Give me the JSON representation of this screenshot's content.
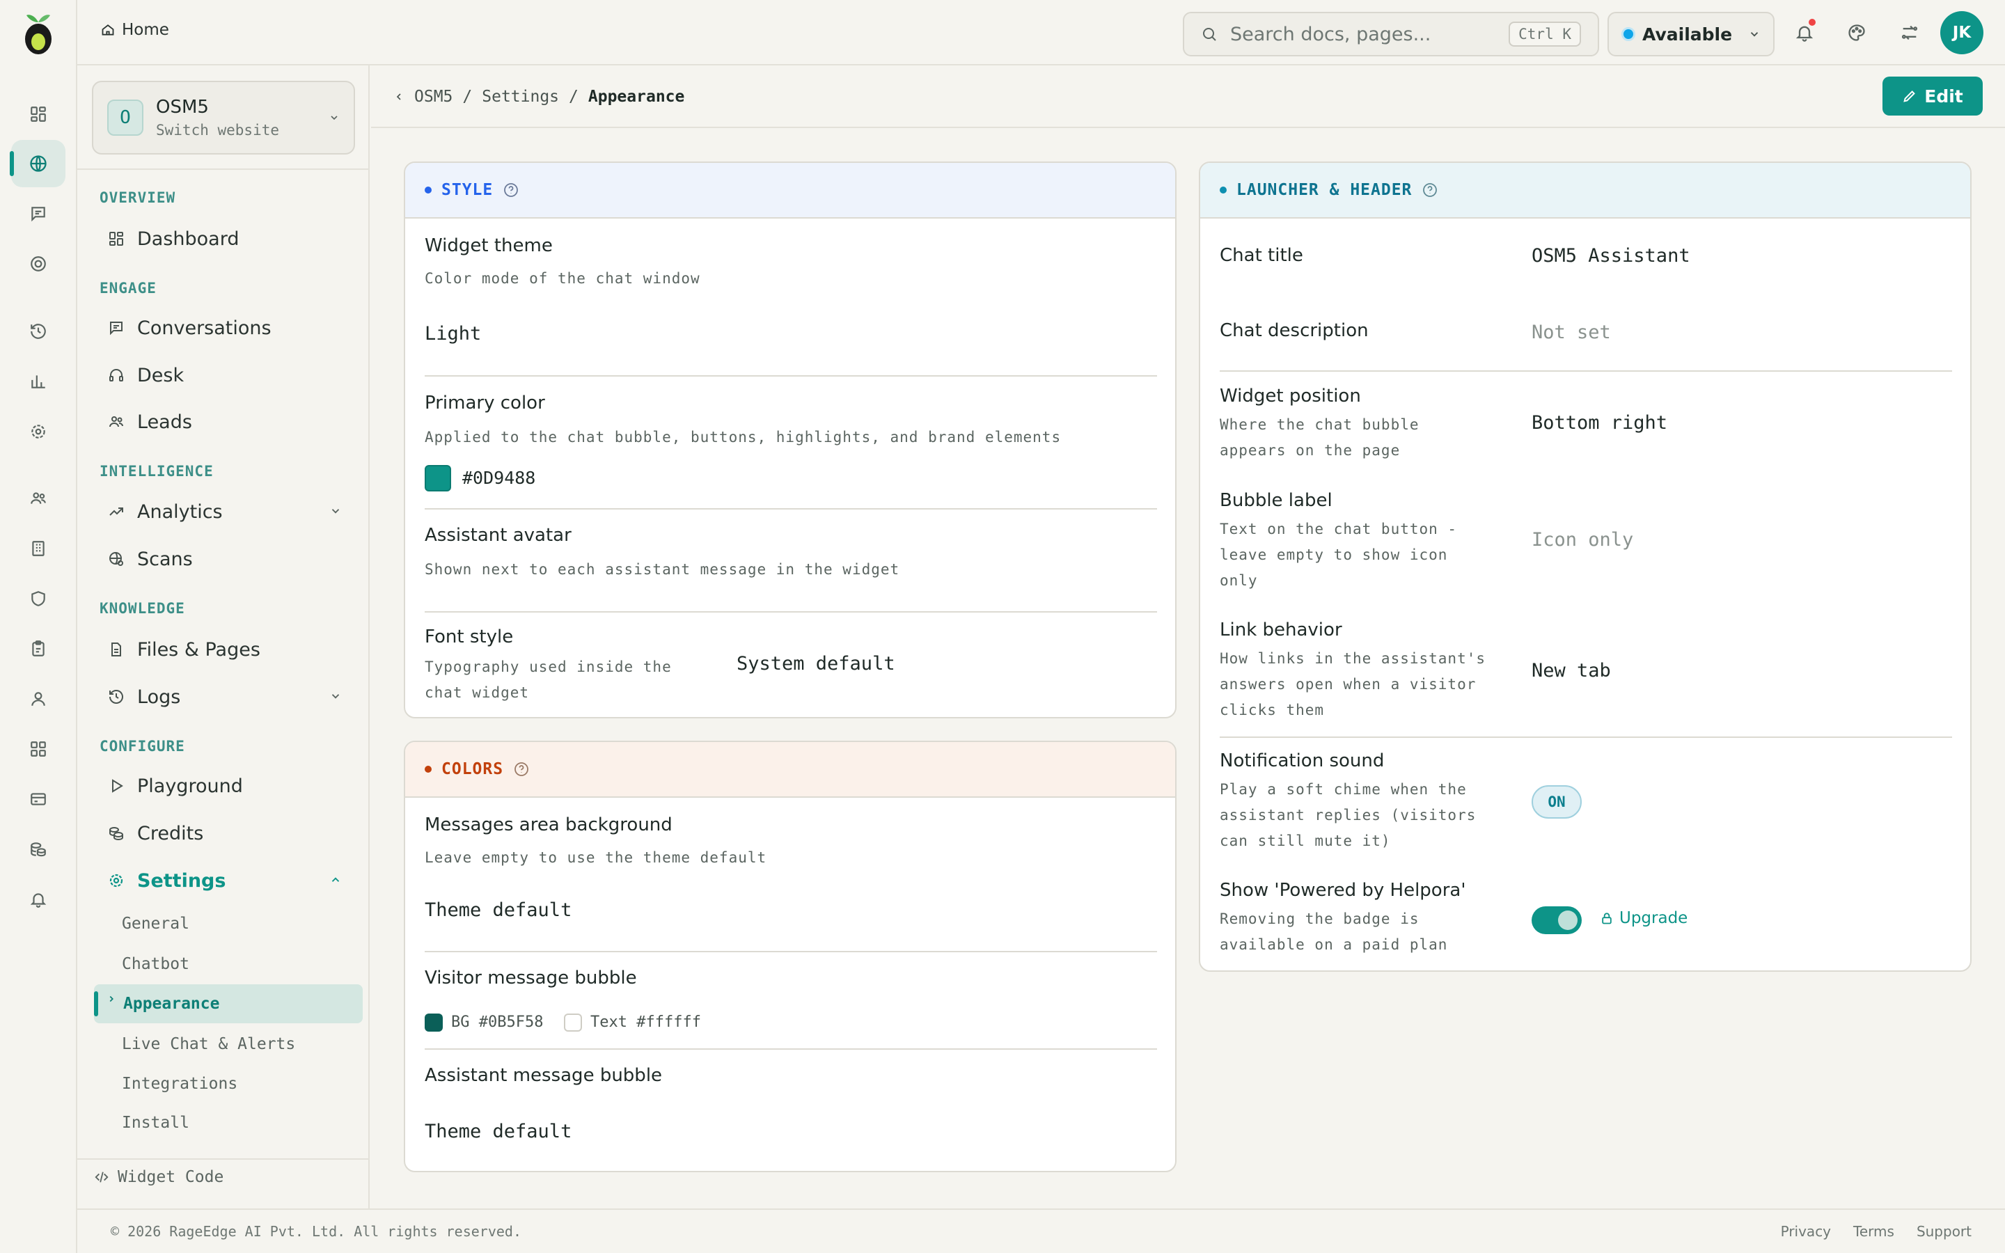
{
  "topbar": {
    "home_label": "Home",
    "search_placeholder": "Search docs, pages...",
    "search_shortcut": "Ctrl K",
    "status_label": "Available",
    "user_initials": "JK"
  },
  "site": {
    "initial": "O",
    "name": "OSM5",
    "switch_label": "Switch website"
  },
  "sidebar": {
    "sections": [
      "OVERVIEW",
      "ENGAGE",
      "INTELLIGENCE",
      "KNOWLEDGE",
      "CONFIGURE"
    ],
    "items": {
      "dashboard": "Dashboard",
      "conversations": "Conversations",
      "desk": "Desk",
      "leads": "Leads",
      "analytics": "Analytics",
      "scans": "Scans",
      "files": "Files & Pages",
      "logs": "Logs",
      "playground": "Playground",
      "credits": "Credits",
      "settings": "Settings"
    },
    "settings_sub": [
      "General",
      "Chatbot",
      "Appearance",
      "Live Chat & Alerts",
      "Integrations",
      "Install"
    ],
    "widget_code": "Widget Code"
  },
  "breadcrumb": [
    "OSM5",
    "Settings",
    "Appearance"
  ],
  "edit_label": "Edit",
  "style": {
    "header": "STYLE",
    "theme_title": "Widget theme",
    "theme_desc": "Color mode of the chat window",
    "theme_value": "Light",
    "primary_title": "Primary color",
    "primary_desc": "Applied to the chat bubble, buttons, highlights, and brand elements",
    "primary_value": "#0D9488",
    "avatar_title": "Assistant avatar",
    "avatar_desc": "Shown next to each assistant message in the widget",
    "font_title": "Font style",
    "font_desc_1": "Typography used inside the",
    "font_desc_2": "chat widget",
    "font_value": "System default"
  },
  "colors": {
    "header": "COLORS",
    "msg_bg_title": "Messages area background",
    "msg_bg_desc": "Leave empty to use the theme default",
    "msg_bg_value": "Theme default",
    "visitor_title": "Visitor message bubble",
    "visitor_bg": "BG #0B5F58",
    "visitor_text": "Text #ffffff",
    "assistant_title": "Assistant message bubble",
    "assistant_value": "Theme default"
  },
  "launcher": {
    "header": "LAUNCHER & HEADER",
    "chat_title_label": "Chat title",
    "chat_title_value": "OSM5 Assistant",
    "chat_desc_label": "Chat description",
    "chat_desc_value": "Not set",
    "position_title": "Widget position",
    "position_desc_1": "Where the chat bubble",
    "position_desc_2": "appears on the page",
    "position_value": "Bottom right",
    "bubble_title": "Bubble label",
    "bubble_desc_1": "Text on the chat button -",
    "bubble_desc_2": "leave empty to show icon",
    "bubble_desc_3": "only",
    "bubble_value": "Icon only",
    "link_title": "Link behavior",
    "link_desc_1": "How links in the assistant's",
    "link_desc_2": "answers open when a visitor",
    "link_desc_3": "clicks them",
    "link_value": "New tab",
    "sound_title": "Notification sound",
    "sound_desc_1": "Play a soft chime when the",
    "sound_desc_2": "assistant replies (visitors",
    "sound_desc_3": "can still mute it)",
    "sound_value": "ON",
    "powered_title": "Show 'Powered by Helpora'",
    "powered_desc_1": "Removing the badge is",
    "powered_desc_2": "available on a paid plan",
    "upgrade_label": "Upgrade"
  },
  "footer": {
    "copyright": "© 2026 RageEdge AI Pvt. Ltd. All rights reserved.",
    "links": [
      "Privacy",
      "Terms",
      "Support"
    ]
  },
  "colors_palette": {
    "accent": "#0D9488",
    "visitor_bg": "#0B5F58",
    "style_header_bg": "#eef3fc",
    "colors_header_bg": "#fbf1ea",
    "launcher_header_bg": "#e9f4f7"
  }
}
